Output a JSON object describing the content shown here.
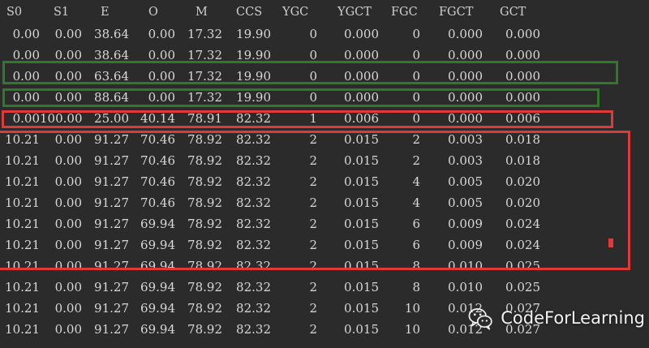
{
  "headers": [
    "S0",
    "S1",
    "E",
    "O",
    "M",
    "CCS",
    "YGC",
    "YGCT",
    "FGC",
    "FGCT",
    "GCT"
  ],
  "rows": [
    [
      "0.00",
      "0.00",
      "38.64",
      "0.00",
      "17.32",
      "19.90",
      "0",
      "0.000",
      "0",
      "0.000",
      "0.000"
    ],
    [
      "0.00",
      "0.00",
      "38.64",
      "0.00",
      "17.32",
      "19.90",
      "0",
      "0.000",
      "0",
      "0.000",
      "0.000"
    ],
    [
      "0.00",
      "0.00",
      "63.64",
      "0.00",
      "17.32",
      "19.90",
      "0",
      "0.000",
      "0",
      "0.000",
      "0.000"
    ],
    [
      "0.00",
      "0.00",
      "88.64",
      "0.00",
      "17.32",
      "19.90",
      "0",
      "0.000",
      "0",
      "0.000",
      "0.000"
    ],
    [
      "0.00",
      "100.00",
      "25.00",
      "40.14",
      "78.91",
      "82.32",
      "1",
      "0.006",
      "0",
      "0.000",
      "0.006"
    ],
    [
      "10.21",
      "0.00",
      "91.27",
      "70.46",
      "78.92",
      "82.32",
      "2",
      "0.015",
      "2",
      "0.003",
      "0.018"
    ],
    [
      "10.21",
      "0.00",
      "91.27",
      "70.46",
      "78.92",
      "82.32",
      "2",
      "0.015",
      "2",
      "0.003",
      "0.018"
    ],
    [
      "10.21",
      "0.00",
      "91.27",
      "70.46",
      "78.92",
      "82.32",
      "2",
      "0.015",
      "4",
      "0.005",
      "0.020"
    ],
    [
      "10.21",
      "0.00",
      "91.27",
      "70.46",
      "78.92",
      "82.32",
      "2",
      "0.015",
      "4",
      "0.005",
      "0.020"
    ],
    [
      "10.21",
      "0.00",
      "91.27",
      "69.94",
      "78.92",
      "82.32",
      "2",
      "0.015",
      "6",
      "0.009",
      "0.024"
    ],
    [
      "10.21",
      "0.00",
      "91.27",
      "69.94",
      "78.92",
      "82.32",
      "2",
      "0.015",
      "6",
      "0.009",
      "0.024"
    ],
    [
      "10.21",
      "0.00",
      "91.27",
      "69.94",
      "78.92",
      "82.32",
      "2",
      "0.015",
      "8",
      "0.010",
      "0.025"
    ],
    [
      "10.21",
      "0.00",
      "91.27",
      "69.94",
      "78.92",
      "82.32",
      "2",
      "0.015",
      "8",
      "0.010",
      "0.025"
    ],
    [
      "10.21",
      "0.00",
      "91.27",
      "69.94",
      "78.92",
      "82.32",
      "2",
      "0.015",
      "10",
      "0.012",
      "0.027"
    ],
    [
      "10.21",
      "0.00",
      "91.27",
      "69.94",
      "78.92",
      "82.32",
      "2",
      "0.015",
      "10",
      "0.012",
      "0.027"
    ]
  ],
  "watermark": {
    "text": "CodeForLearning",
    "icon": "wechat-icon"
  },
  "colors": {
    "background": "#2b2b2b",
    "text": "#d8d8d8",
    "highlight_green": "#2f7a2a",
    "highlight_red": "#e0393a"
  }
}
